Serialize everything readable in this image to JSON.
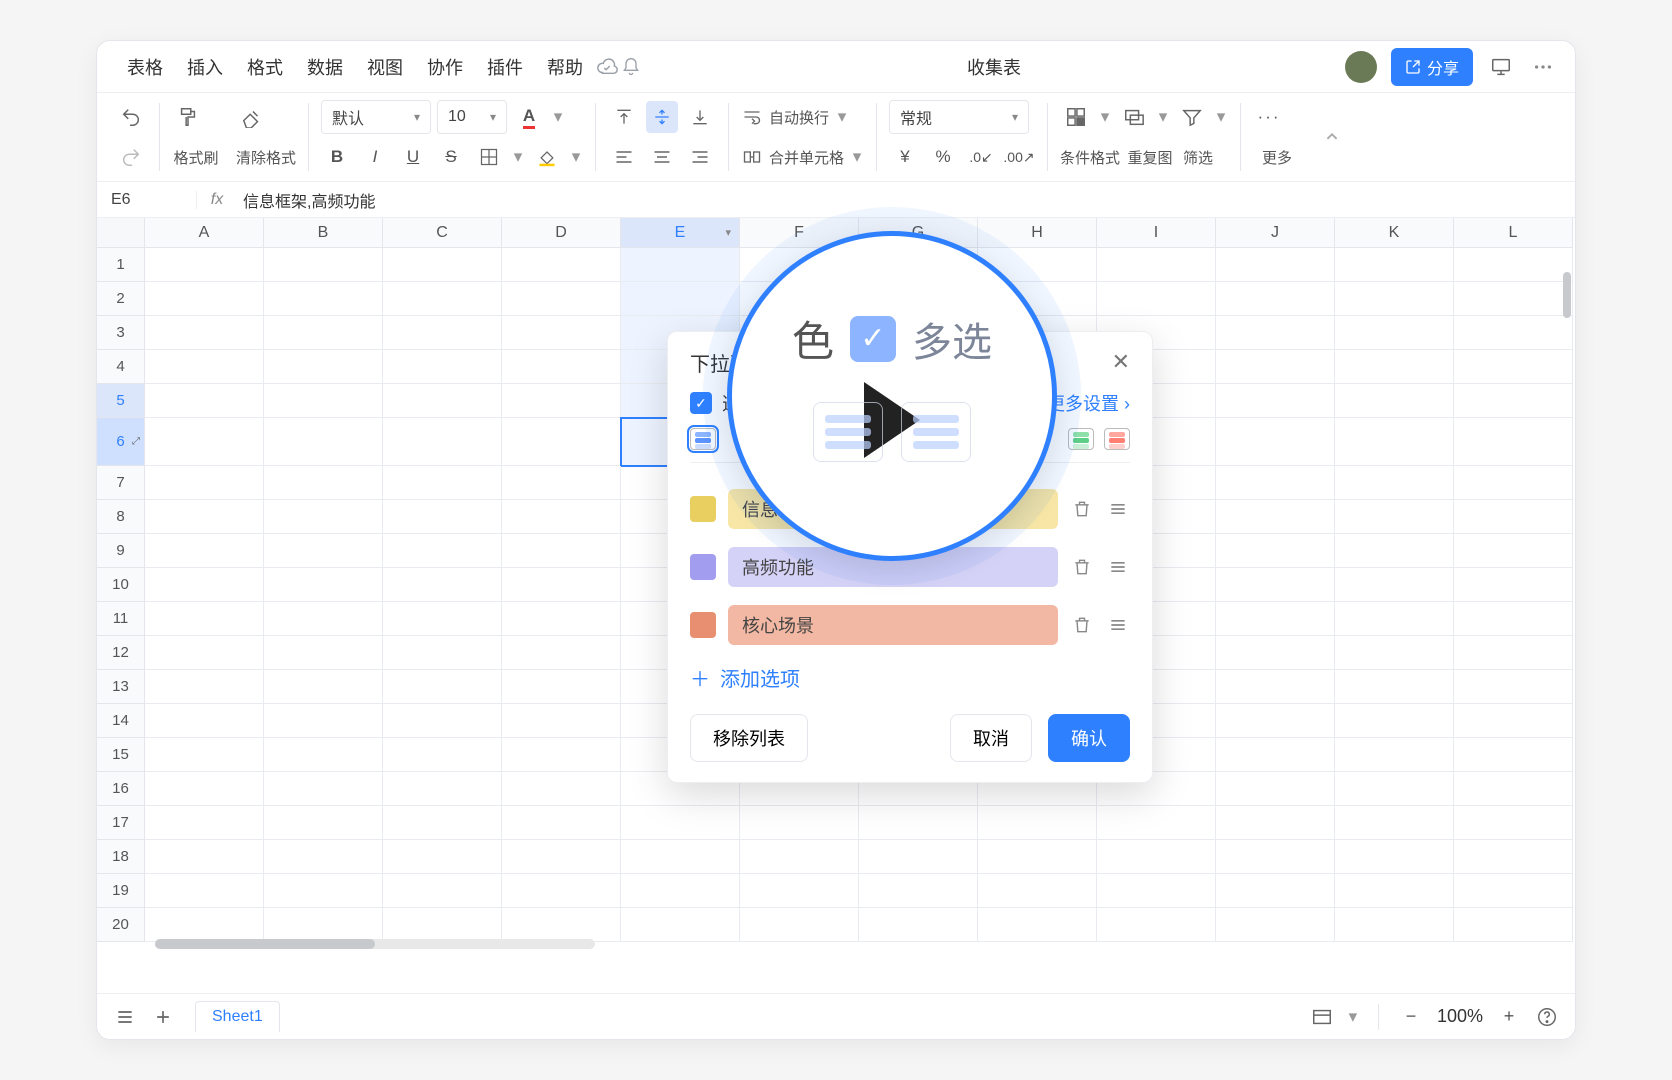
{
  "menubar": {
    "items": [
      "表格",
      "插入",
      "格式",
      "数据",
      "视图",
      "协作",
      "插件",
      "帮助"
    ],
    "doc_title": "收集表",
    "share_label": "分享"
  },
  "toolbar": {
    "format_painter": "格式刷",
    "clear_format": "清除格式",
    "font_family": "默认",
    "font_size": "10",
    "wrap_label": "自动换行",
    "merge_label": "合并单元格",
    "number_format": "常规",
    "cond_format": "条件格式",
    "repeat_image": "重复图",
    "filter": "筛选",
    "more": "更多"
  },
  "formula_bar": {
    "cell_ref": "E6",
    "fx": "fx",
    "content": "信息框架,高频功能"
  },
  "grid": {
    "columns": [
      "A",
      "B",
      "C",
      "D",
      "E",
      "F",
      "G",
      "H",
      "I",
      "J",
      "K",
      "L"
    ],
    "selected_column": "E",
    "active_row": 6,
    "row_count": 20
  },
  "statusbar": {
    "sheet_name": "Sheet1",
    "zoom": "100%"
  },
  "panel": {
    "title": "下拉列",
    "checkbox_label": "选",
    "more_settings": "更多设置 ›",
    "items": [
      {
        "label": "信息框架",
        "bg": "#f7e6a6",
        "sw": "#e8cf5f"
      },
      {
        "label": "高频功能",
        "bg": "#d5d2f7",
        "sw": "#a39df0"
      },
      {
        "label": "核心场景",
        "bg": "#f3b8a3",
        "sw": "#e88f71"
      }
    ],
    "add_option": "添加选项",
    "remove_list": "移除列表",
    "cancel": "取消",
    "confirm": "确认"
  },
  "overlay": {
    "left_text": "色",
    "right_text": "多选"
  }
}
